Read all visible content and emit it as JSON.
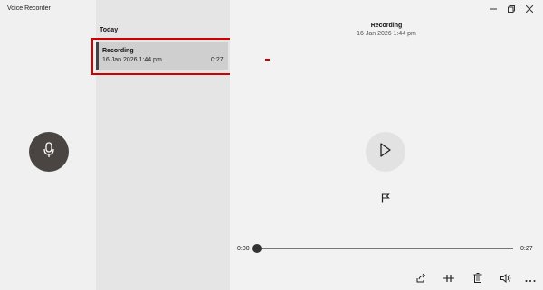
{
  "window": {
    "title": "Voice Recorder"
  },
  "recorder": {
    "mic_icon": "microphone-icon"
  },
  "list": {
    "header": "Today",
    "items": [
      {
        "title": "Recording",
        "date": "16 Jan 2026 1:44 pm",
        "duration": "0:27",
        "selected": true
      }
    ]
  },
  "detail": {
    "title": "Recording",
    "date": "16 Jan 2026 1:44 pm"
  },
  "playback": {
    "position_label": "0:00",
    "duration_label": "0:27",
    "progress": 0.0
  },
  "colors": {
    "highlight": "#d10000",
    "mic_button": "#4a4543",
    "list_bg": "#e5e5e5",
    "selected_bg": "#cfcfcf"
  },
  "icons": {
    "play": "play-icon",
    "flag": "flag-icon",
    "share": "share-icon",
    "trim": "trim-icon",
    "delete": "delete-icon",
    "volume": "volume-icon",
    "more": "more-icon",
    "minimize": "minimize-icon",
    "maximize": "maximize-icon",
    "close": "close-icon"
  }
}
